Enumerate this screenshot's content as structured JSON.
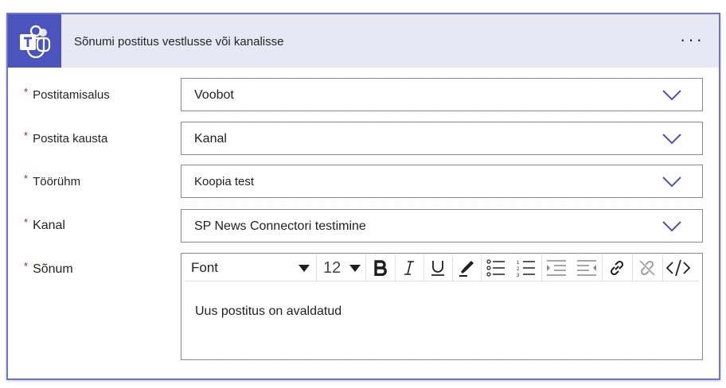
{
  "header": {
    "title": "Sõnumi postitus vestlusse või kanalisse",
    "logo_icon": "teams-logo-icon",
    "more_icon": "more-options-icon",
    "more_label": "···"
  },
  "fields": [
    {
      "label": "Postitamisalus",
      "value": "Voobot",
      "required": true
    },
    {
      "label": "Postita kausta",
      "value": "Kanal",
      "required": true
    },
    {
      "label": "Töörühm",
      "value": "Koopia test",
      "required": true
    },
    {
      "label": "Kanal",
      "value": "SP News Connectori testimine",
      "required": true
    }
  ],
  "message": {
    "label": "Sõnum",
    "required": true,
    "toolbar": {
      "font": "Font",
      "size": "12",
      "buttons": [
        "bold-icon",
        "italic-icon",
        "underline-icon",
        "highlight-icon",
        "bullet-list-icon",
        "numbered-list-icon",
        "decrease-indent-icon",
        "increase-indent-icon",
        "link-icon",
        "unlink-icon",
        "code-view-icon"
      ]
    },
    "content": "Uus postitus on avaldatud"
  },
  "required_marker": "*",
  "colors": {
    "accent": "#4b53bc",
    "header_bg": "#e8e8f5",
    "border": "#7174c9",
    "required": "#a4262c"
  }
}
